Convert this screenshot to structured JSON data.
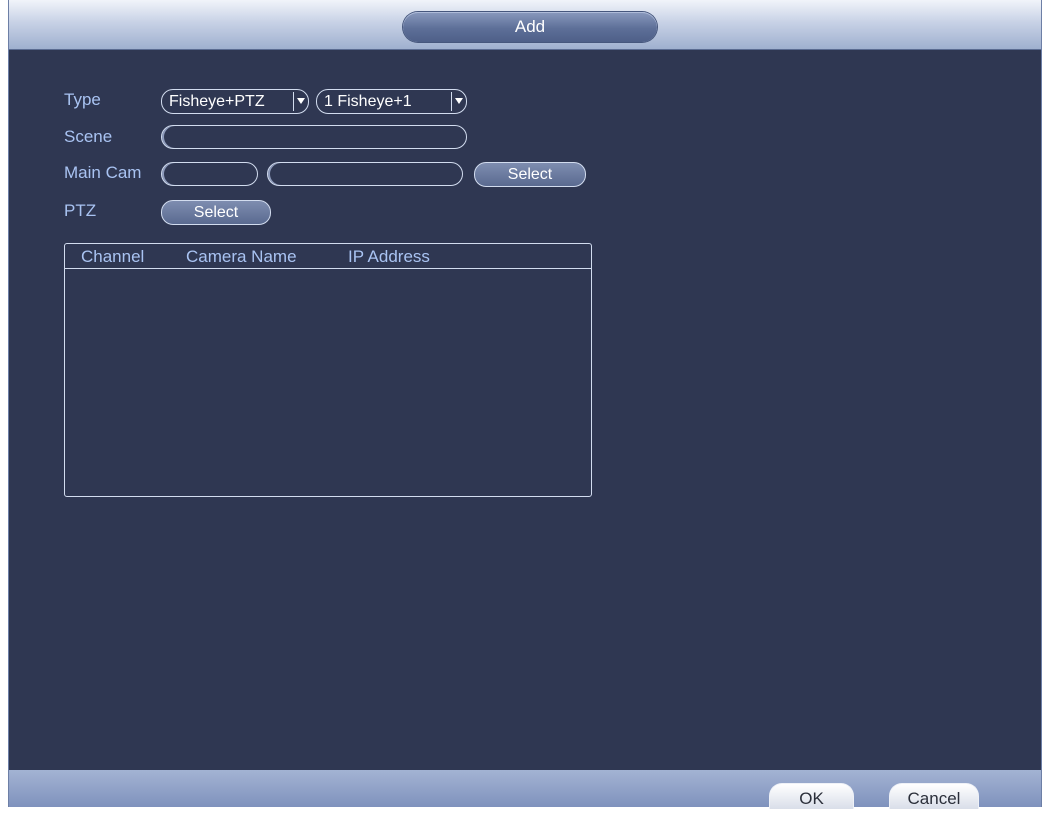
{
  "dialog": {
    "title": "Add",
    "colors": {
      "background": "#2f3752",
      "label": "#a9c3f2",
      "border": "#d2dcef"
    }
  },
  "form": {
    "type_label": "Type",
    "type_value": "Fisheye+PTZ",
    "mode_value": "1 Fisheye+1",
    "scene_label": "Scene",
    "scene_value": "",
    "main_cam_label": "Main Cam",
    "main_cam_channel": "",
    "main_cam_name": "",
    "main_cam_select": "Select",
    "ptz_label": "PTZ",
    "ptz_select": "Select"
  },
  "table": {
    "columns": [
      "Channel",
      "Camera Name",
      "IP Address"
    ],
    "rows": []
  },
  "footer": {
    "ok": "OK",
    "cancel": "Cancel"
  }
}
